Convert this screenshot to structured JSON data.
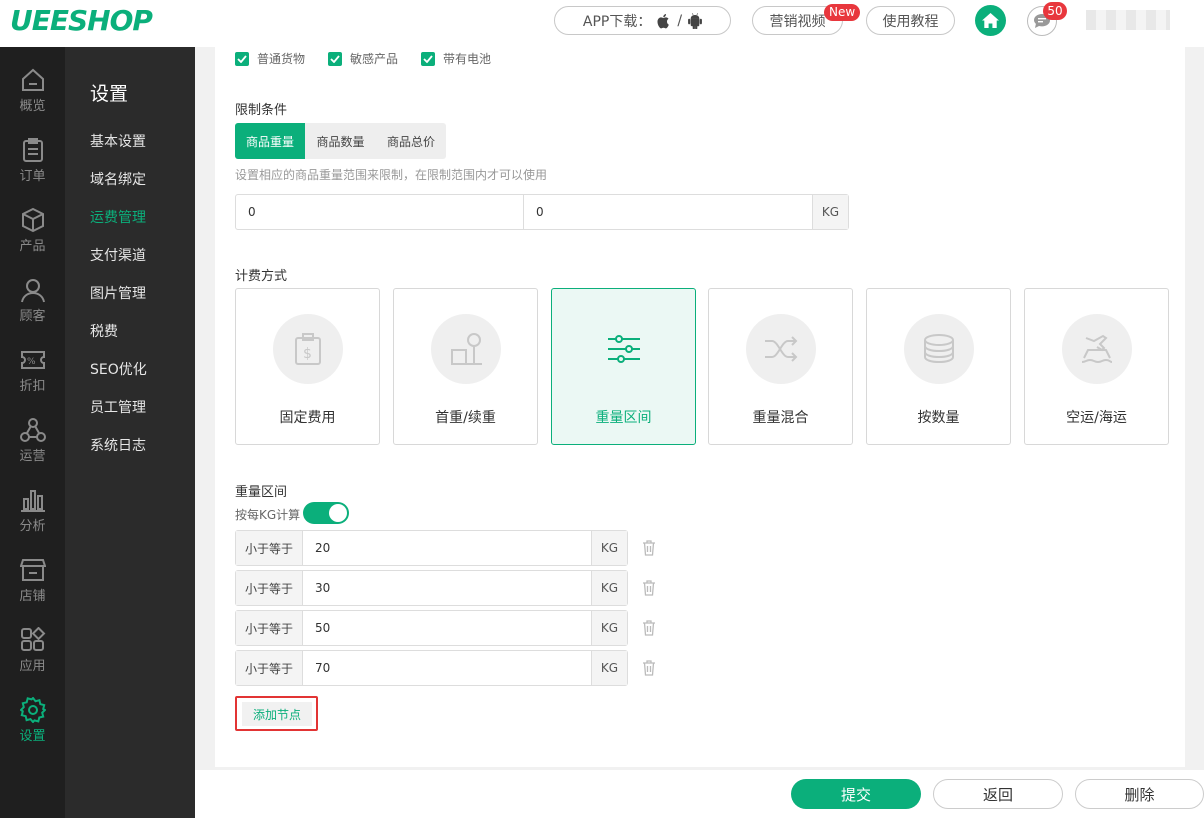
{
  "header": {
    "logo": "UEESHOP",
    "app_download": "APP下载：",
    "separator": "/",
    "marketing_video": "营销视频",
    "new_badge": "New",
    "tutorial": "使用教程",
    "message_count": "50"
  },
  "leftnav": [
    {
      "label": "概览",
      "icon": "home-outline-icon"
    },
    {
      "label": "订单",
      "icon": "clipboard-icon"
    },
    {
      "label": "产品",
      "icon": "box-icon"
    },
    {
      "label": "顾客",
      "icon": "user-icon"
    },
    {
      "label": "折扣",
      "icon": "discount-icon"
    },
    {
      "label": "运营",
      "icon": "network-icon"
    },
    {
      "label": "分析",
      "icon": "bar-chart-icon"
    },
    {
      "label": "店铺",
      "icon": "store-icon"
    },
    {
      "label": "应用",
      "icon": "apps-icon"
    },
    {
      "label": "设置",
      "icon": "gear-icon"
    }
  ],
  "submenu": {
    "title": "设置",
    "items": [
      "基本设置",
      "域名绑定",
      "运费管理",
      "支付渠道",
      "图片管理",
      "税费",
      "SEO优化",
      "员工管理",
      "系统日志"
    ],
    "active": "运费管理"
  },
  "checkboxes": [
    "普通货物",
    "敏感产品",
    "带有电池"
  ],
  "limit": {
    "label": "限制条件",
    "tabs": [
      "商品重量",
      "商品数量",
      "商品总价"
    ],
    "hint": "设置相应的商品重量范围来限制，在限制范围内才可以使用",
    "min": "0",
    "max": "0",
    "unit": "KG"
  },
  "billing": {
    "label": "计费方式",
    "cards": [
      "固定费用",
      "首重/续重",
      "重量区间",
      "重量混合",
      "按数量",
      "空运/海运"
    ],
    "active": "重量区间"
  },
  "weight_range": {
    "title": "重量区间",
    "toggle_label": "按每KG计算",
    "toggle_on": true,
    "prefix": "小于等于",
    "unit": "KG",
    "rows": [
      "20",
      "30",
      "50",
      "70"
    ],
    "add_label": "添加节点"
  },
  "footer": {
    "submit": "提交",
    "back": "返回",
    "delete": "删除"
  },
  "colors": {
    "accent": "#0baf7b",
    "badge": "#e8373d"
  }
}
